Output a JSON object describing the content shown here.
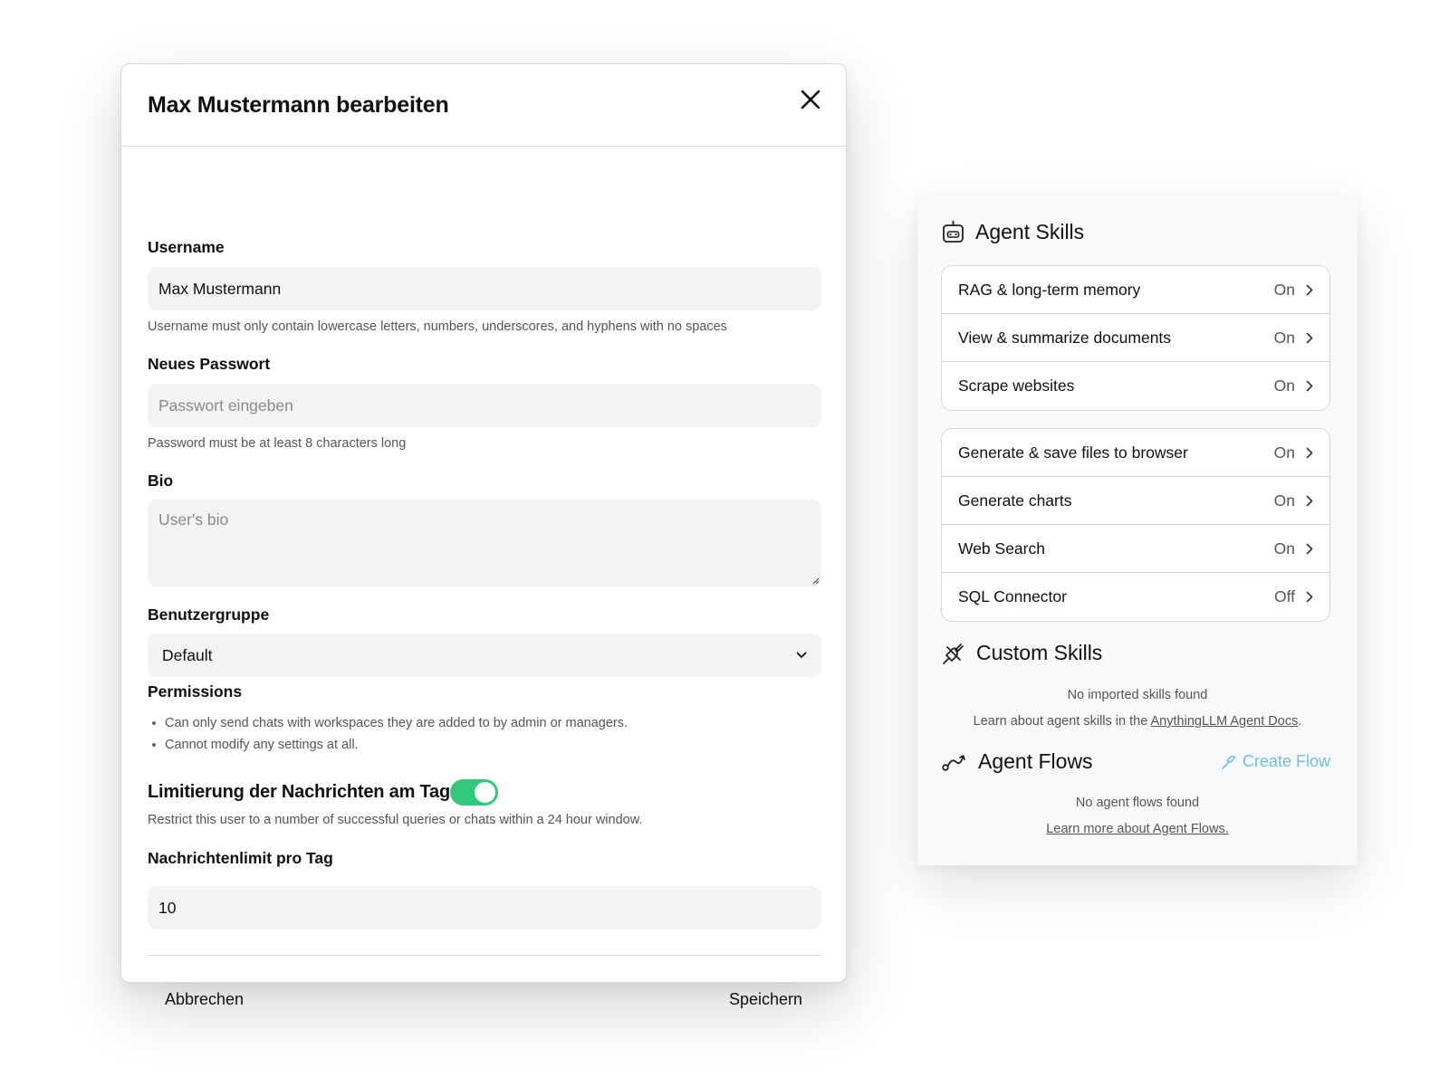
{
  "modal": {
    "title": "Max Mustermann bearbeiten",
    "username": {
      "label": "Username",
      "value": "Max Mustermann",
      "hint": "Username must only contain lowercase letters, numbers, underscores, and hyphens with no spaces"
    },
    "password": {
      "label": "Neues Passwort",
      "placeholder": "Passwort eingeben",
      "hint": "Password must be at least 8 characters long"
    },
    "bio": {
      "label": "Bio",
      "placeholder": "User's bio"
    },
    "group": {
      "label": "Benutzergruppe",
      "selected": "Default"
    },
    "permissions": {
      "label": "Permissions",
      "items": [
        "Can only send chats with workspaces they are added to by admin or managers.",
        "Cannot modify any settings at all."
      ]
    },
    "limit": {
      "title": "Limitierung der Nachrichten am Tag",
      "enabled": true,
      "description": "Restrict this user to a number of successful queries or chats within a 24 hour window."
    },
    "daily_limit": {
      "label": "Nachrichtenlimit pro Tag",
      "value": "10"
    },
    "footer": {
      "cancel": "Abbrechen",
      "save": "Speichern"
    }
  },
  "panel": {
    "agent_skills": {
      "title": "Agent Skills",
      "icon": "robot-icon",
      "groups": [
        [
          {
            "name": "RAG & long-term memory",
            "status": "On"
          },
          {
            "name": "View & summarize documents",
            "status": "On"
          },
          {
            "name": "Scrape websites",
            "status": "On"
          }
        ],
        [
          {
            "name": "Generate & save files to browser",
            "status": "On"
          },
          {
            "name": "Generate charts",
            "status": "On"
          },
          {
            "name": "Web Search",
            "status": "On"
          },
          {
            "name": "SQL Connector",
            "status": "Off"
          }
        ]
      ]
    },
    "custom_skills": {
      "title": "Custom Skills",
      "icon": "plug-icon",
      "empty": "No imported skills found",
      "learn_prefix": "Learn about agent skills in the ",
      "learn_link": "AnythingLLM Agent Docs",
      "learn_suffix": "."
    },
    "agent_flows": {
      "title": "Agent Flows",
      "icon": "flow-icon",
      "create_label": "Create Flow",
      "accent": "#6ec1d6",
      "empty": "No agent flows found",
      "learn_link": "Learn more about Agent Flows."
    }
  },
  "colors": {
    "toggle_on": "#30c97a",
    "input_bg": "#f3f3f3",
    "panel_bg": "#f8f9fb"
  }
}
